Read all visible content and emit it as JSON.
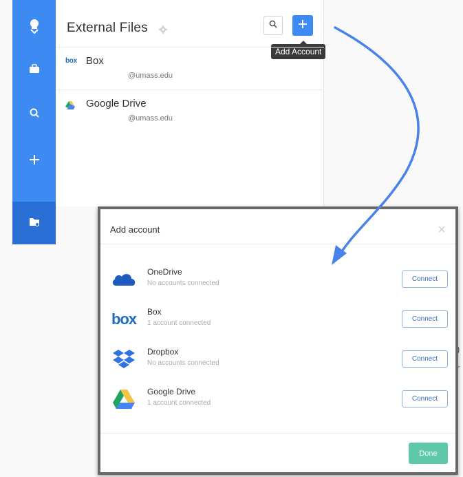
{
  "sidebar": {
    "items": [
      {
        "icon": "user-avatar-icon"
      },
      {
        "icon": "briefcase-icon"
      },
      {
        "icon": "search-icon"
      },
      {
        "icon": "plus-icon"
      },
      {
        "icon": "folder-icon"
      }
    ],
    "accent": "#3d8bf2"
  },
  "panel": {
    "title": "External Files",
    "tooltip": "Add Account",
    "files": [
      {
        "name": "Box",
        "logo": "box",
        "account": "@umass.edu"
      },
      {
        "name": "Google Drive",
        "logo": "google-drive",
        "account": "@umass.edu"
      }
    ]
  },
  "background_fragments": [
    ")",
    "r"
  ],
  "modal": {
    "title": "Add account",
    "close": "×",
    "accounts": [
      {
        "name": "OneDrive",
        "status": "No accounts connected",
        "button": "Connect",
        "logo": "onedrive-icon"
      },
      {
        "name": "Box",
        "status": "1 account connected",
        "button": "Connect",
        "logo": "box-logo"
      },
      {
        "name": "Dropbox",
        "status": "No accounts connected",
        "button": "Connect",
        "logo": "dropbox-icon"
      },
      {
        "name": "Google Drive",
        "status": "1 account connected",
        "button": "Connect",
        "logo": "google-drive-icon"
      }
    ],
    "done_label": "Done",
    "done_color": "#5fc8ab",
    "box_logo_text": "box"
  }
}
